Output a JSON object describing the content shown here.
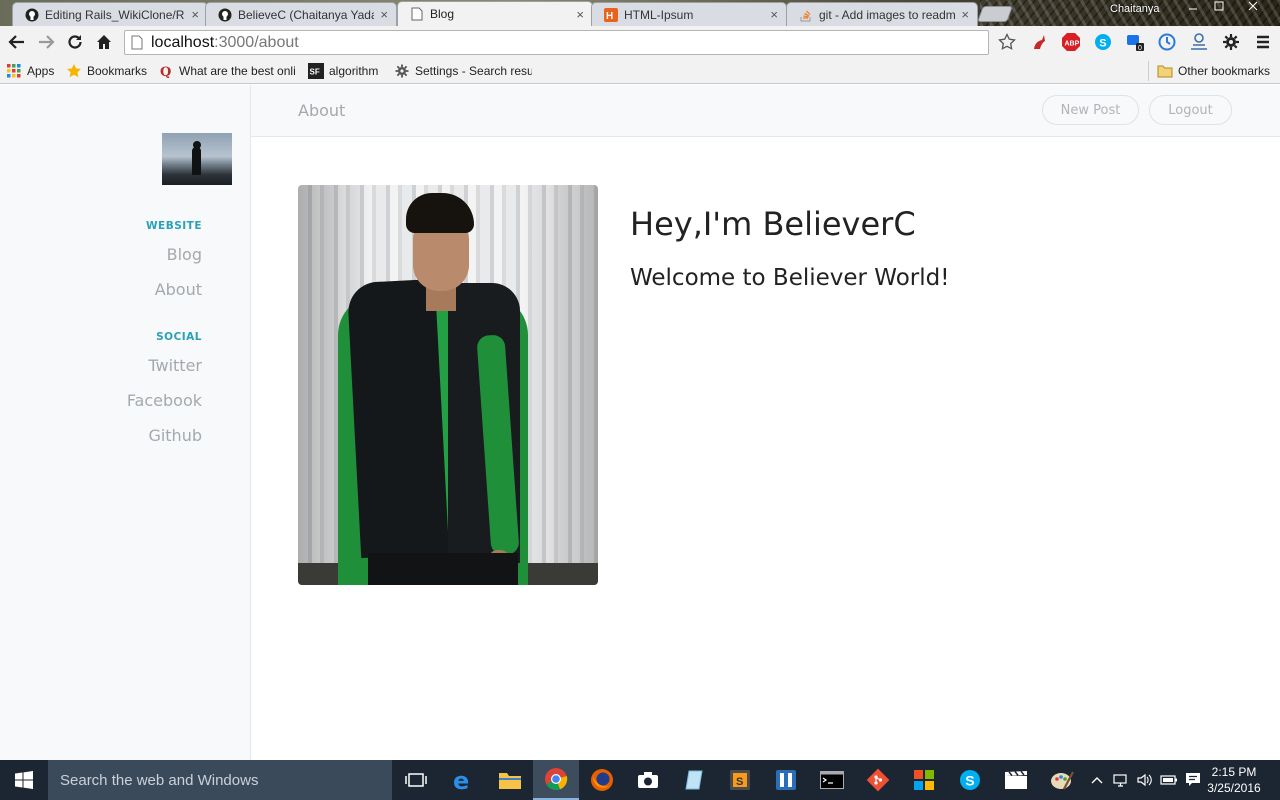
{
  "browser": {
    "tabs": [
      {
        "title": "Editing Rails_WikiClone/R",
        "icon": "github-icon"
      },
      {
        "title": "BelieveC (Chaitanya Yadav",
        "icon": "github-icon"
      },
      {
        "title": "Blog",
        "icon": "page-icon"
      },
      {
        "title": "HTML-Ipsum",
        "icon": "html-ipsum-icon"
      },
      {
        "title": "git - Add images to readm",
        "icon": "stackoverflow-icon"
      }
    ],
    "tab_close": "×",
    "user_label": "Chaitanya",
    "url_host": "localhost",
    "url_path": ":3000/about",
    "bookmarks": [
      {
        "label": "Apps",
        "icon": "apps-grid-icon"
      },
      {
        "label": "Bookmarks",
        "icon": "star-icon"
      },
      {
        "label": "What are the best onli",
        "icon": "quora-icon"
      },
      {
        "label": "algorithm",
        "icon": "sf-icon"
      },
      {
        "label": "Settings - Search resu",
        "icon": "gear-icon"
      }
    ],
    "other_bookmarks": "Other bookmarks"
  },
  "site": {
    "header": {
      "title": "About",
      "new_post": "New Post",
      "logout": "Logout"
    },
    "sidebar": {
      "website_heading": "WEBSITE",
      "website_links": [
        "Blog",
        "About"
      ],
      "social_heading": "SOCIAL",
      "social_links": [
        "Twitter",
        "Facebook",
        "Github"
      ]
    },
    "hero": {
      "title": "Hey,I'm BelieverC",
      "subtitle": "Welcome to Believer World!"
    }
  },
  "taskbar": {
    "search_placeholder": "Search the web and Windows",
    "time": "2:15 PM",
    "date": "3/25/2016"
  },
  "colors": {
    "accent": "#2aa0b9",
    "muted_link": "#a3a9ae",
    "sidebar_bg": "#f7f9fa"
  }
}
